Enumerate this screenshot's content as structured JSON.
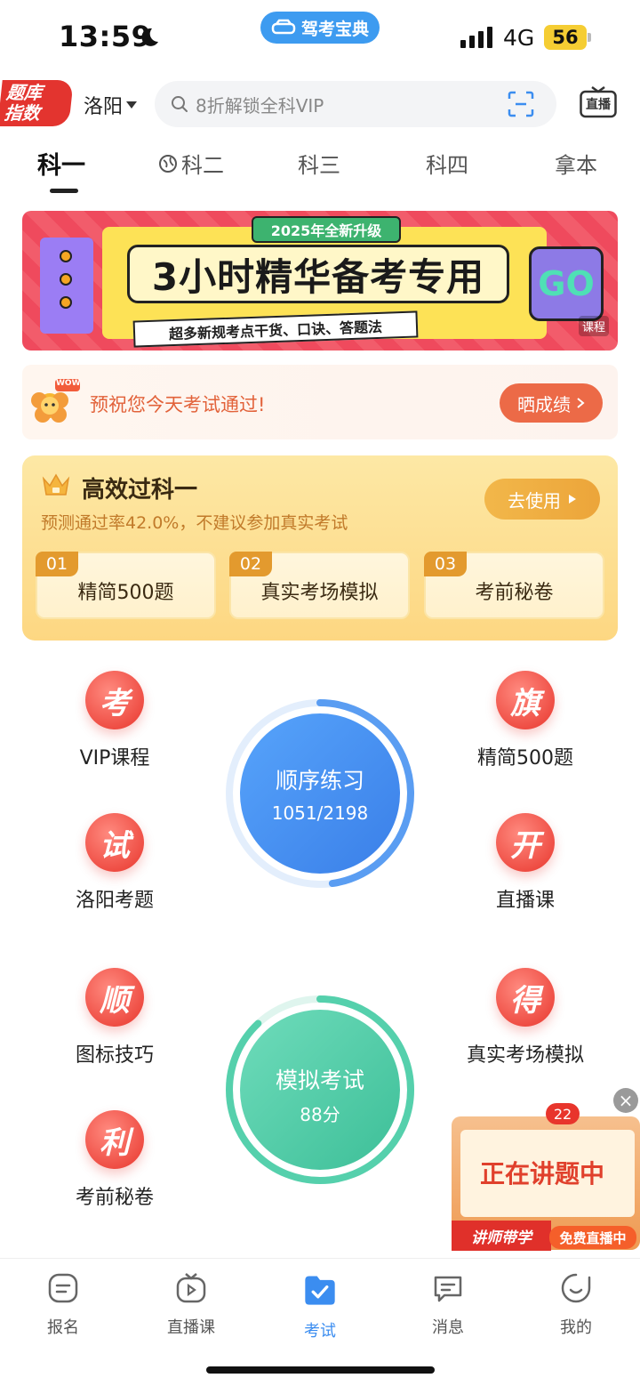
{
  "status_bar": {
    "time": "13:59",
    "network": "4G",
    "battery": "56"
  },
  "app_pill": {
    "label": "驾考宝典"
  },
  "header": {
    "bank_logo": "题库\n指数",
    "city": "洛阳",
    "search_placeholder": "8折解锁全科VIP",
    "live_icon_label": "直播"
  },
  "subject_tabs": [
    {
      "label": "科一",
      "active": true
    },
    {
      "label": "科二"
    },
    {
      "label": "科三"
    },
    {
      "label": "科四"
    },
    {
      "label": "拿本"
    }
  ],
  "banner": {
    "tag": "2025年全新升级",
    "title": "3小时精华备考专用",
    "subtitle": "超多新规考点干货、口诀、答题法",
    "go": "GO",
    "course": "课程"
  },
  "wish": {
    "badge": "WOW",
    "text": "预祝您今天考试通过!",
    "button": "晒成绩"
  },
  "efficient": {
    "title": "高效过科一",
    "subtitle": "预测通过率42.0%，不建议参加真实考试",
    "button": "去使用",
    "items": [
      {
        "num": "01",
        "label": "精简500题"
      },
      {
        "num": "02",
        "label": "真实考场模拟"
      },
      {
        "num": "03",
        "label": "考前秘卷"
      }
    ]
  },
  "features": [
    {
      "glyph": "考",
      "label": "VIP课程"
    },
    {
      "glyph": "旗",
      "label": "精简500题"
    },
    {
      "glyph": "试",
      "label": "洛阳考题"
    },
    {
      "glyph": "开",
      "label": "直播课"
    },
    {
      "glyph": "顺",
      "label": "图标技巧"
    },
    {
      "glyph": "得",
      "label": "真实考场模拟"
    },
    {
      "glyph": "利",
      "label": "考前秘卷"
    }
  ],
  "practice": {
    "title": "顺序练习",
    "progress_text": "1051/2198",
    "progress": 0.478,
    "color": "#4a8ff0"
  },
  "mock_exam": {
    "title": "模拟考试",
    "score": "88分",
    "progress": 0.88,
    "color": "#4ccaa5"
  },
  "floating_live": {
    "badge": "22",
    "text": "正在讲题中",
    "teacher": "讲师带学",
    "free": "免费直播中",
    "close": "×"
  },
  "bottom_nav": [
    {
      "label": "报名",
      "icon": "register-icon"
    },
    {
      "label": "直播课",
      "icon": "tv-icon"
    },
    {
      "label": "考试",
      "icon": "exam-folder-icon",
      "active": true
    },
    {
      "label": "消息",
      "icon": "message-icon"
    },
    {
      "label": "我的",
      "icon": "profile-icon"
    }
  ]
}
